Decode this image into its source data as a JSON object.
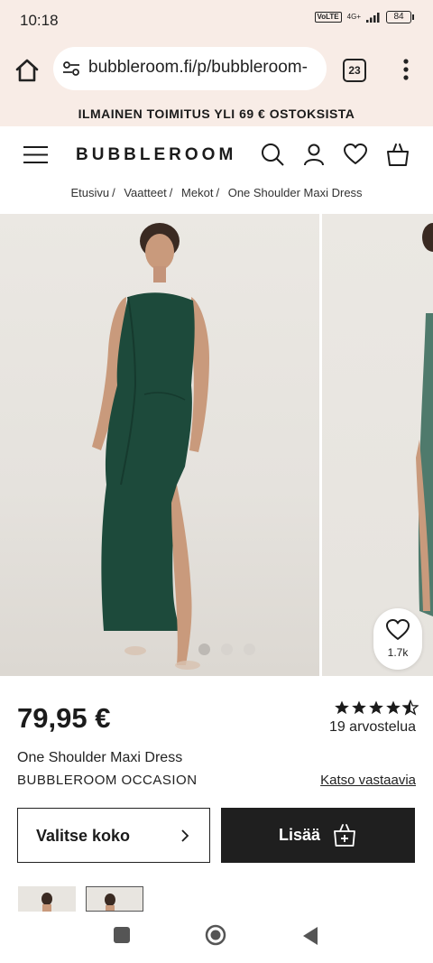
{
  "status_bar": {
    "time": "10:18",
    "network_badge": "VoLTE",
    "network_type": "4G+",
    "battery": "84"
  },
  "browser": {
    "url": "bubbleroom.fi/p/bubbleroom-",
    "tab_count": "23"
  },
  "promo": {
    "text": "ILMAINEN TOIMITUS YLI 69 € OSTOKSISTA"
  },
  "header": {
    "logo": "BUBBLEROOM"
  },
  "breadcrumb": {
    "items": [
      "Etusivu",
      "Vaatteet",
      "Mekot",
      "One Shoulder Maxi Dress"
    ],
    "separator": "/"
  },
  "gallery": {
    "image_count": 3,
    "active_index": 0,
    "wishlist_count": "1.7k",
    "dress_color": "#1d4a3b"
  },
  "product": {
    "price": "79,95 €",
    "rating": 4.5,
    "reviews_label": "19 arvostelua",
    "name": "One Shoulder Maxi Dress",
    "brand": "BUBBLEROOM OCCASION",
    "similar_link": "Katso vastaavia"
  },
  "actions": {
    "select_size": "Valitse koko",
    "add_to_cart": "Lisää"
  },
  "colors": {
    "promo_bg": "#f8ece6",
    "primary_button": "#1f1f1f"
  }
}
